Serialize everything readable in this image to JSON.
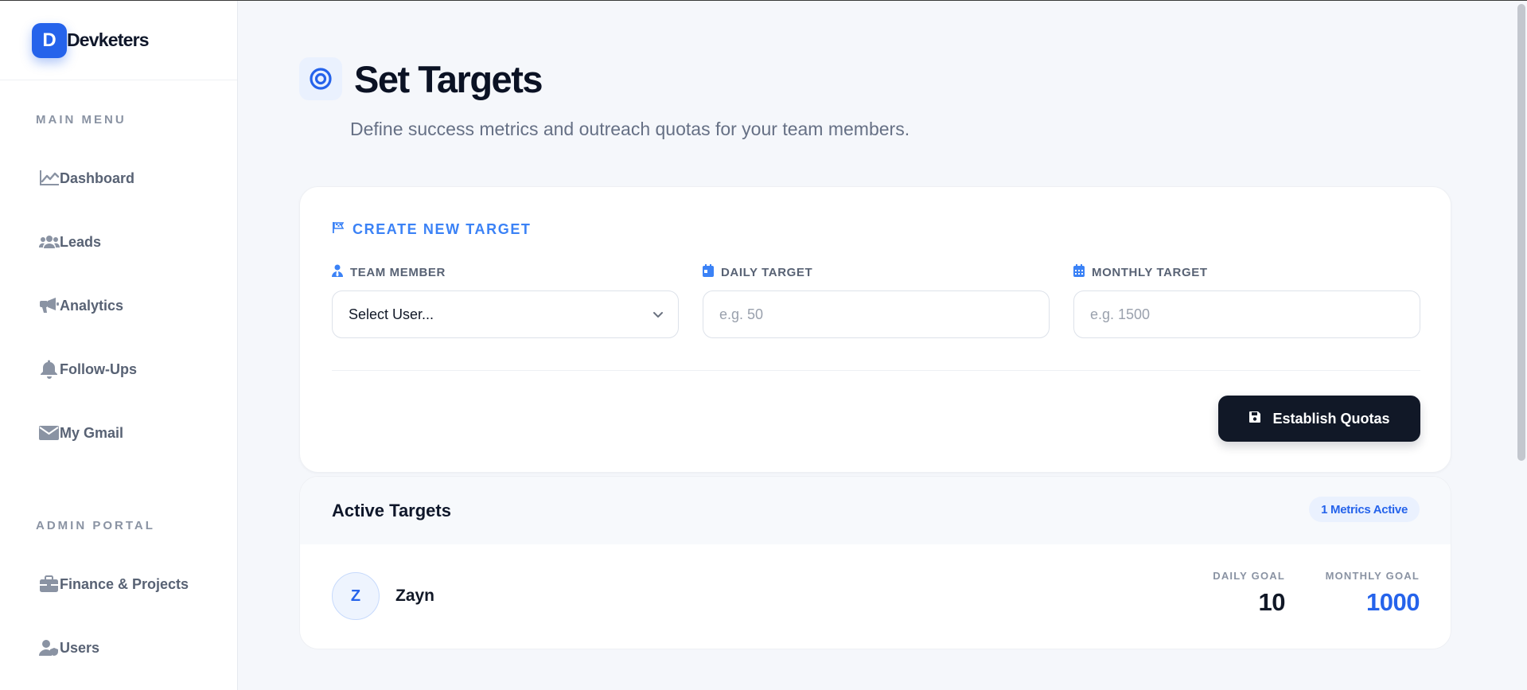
{
  "brand": {
    "logo_letter": "D",
    "name": "Devketers"
  },
  "sidebar": {
    "main_menu_label": "MAIN MENU",
    "main_items": [
      {
        "label": "Dashboard",
        "icon": "chart-line-icon"
      },
      {
        "label": "Leads",
        "icon": "users-icon"
      },
      {
        "label": "Analytics",
        "icon": "megaphone-icon"
      },
      {
        "label": "Follow-Ups",
        "icon": "bell-icon"
      },
      {
        "label": "My Gmail",
        "icon": "envelope-icon"
      }
    ],
    "admin_label": "ADMIN PORTAL",
    "admin_items": [
      {
        "label": "Finance & Projects",
        "icon": "briefcase-icon"
      },
      {
        "label": "Users",
        "icon": "user-shield-icon"
      }
    ]
  },
  "page": {
    "title": "Set Targets",
    "subtitle": "Define success metrics and outreach quotas for your team members.",
    "icon": "bullseye-icon"
  },
  "create_form": {
    "title": "CREATE NEW TARGET",
    "team_member": {
      "label": "TEAM MEMBER",
      "value": "Select User..."
    },
    "daily_target": {
      "label": "DAILY TARGET",
      "placeholder": "e.g. 50"
    },
    "monthly_target": {
      "label": "MONTHLY TARGET",
      "placeholder": "e.g. 1500"
    },
    "submit_label": "Establish Quotas"
  },
  "active_targets": {
    "title": "Active Targets",
    "badge": "1 Metrics Active",
    "daily_goal_label": "DAILY GOAL",
    "monthly_goal_label": "MONTHLY GOAL",
    "rows": [
      {
        "initial": "Z",
        "name": "Zayn",
        "daily_goal": "10",
        "monthly_goal": "1000"
      }
    ]
  },
  "colors": {
    "accent": "#2563eb",
    "accent_light": "#3b82f6",
    "dark": "#111827",
    "muted": "#8a93a3"
  }
}
